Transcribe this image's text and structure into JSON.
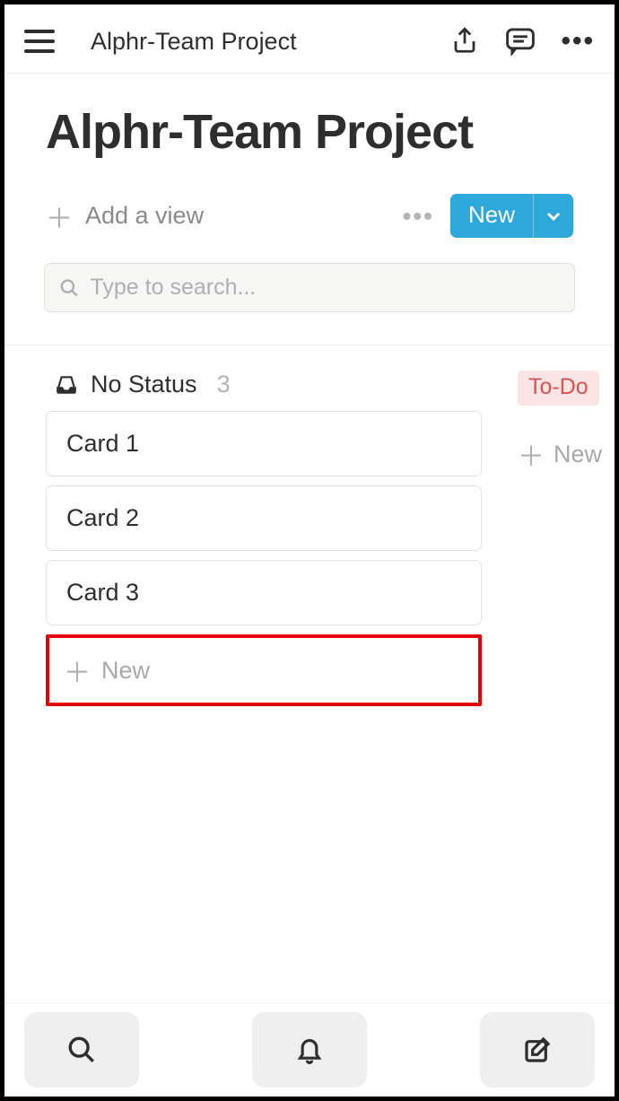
{
  "header": {
    "breadcrumb": "Alphr-Team Project"
  },
  "page": {
    "title": "Alphr-Team Project",
    "add_view_label": "Add a view",
    "new_button_label": "New"
  },
  "search": {
    "placeholder": "Type to search..."
  },
  "board": {
    "columns": [
      {
        "title": "No Status",
        "count": "3",
        "cards": [
          "Card 1",
          "Card 2",
          "Card 3"
        ],
        "new_label": "New"
      },
      {
        "tag": "To-Do",
        "new_label": "New"
      }
    ]
  }
}
